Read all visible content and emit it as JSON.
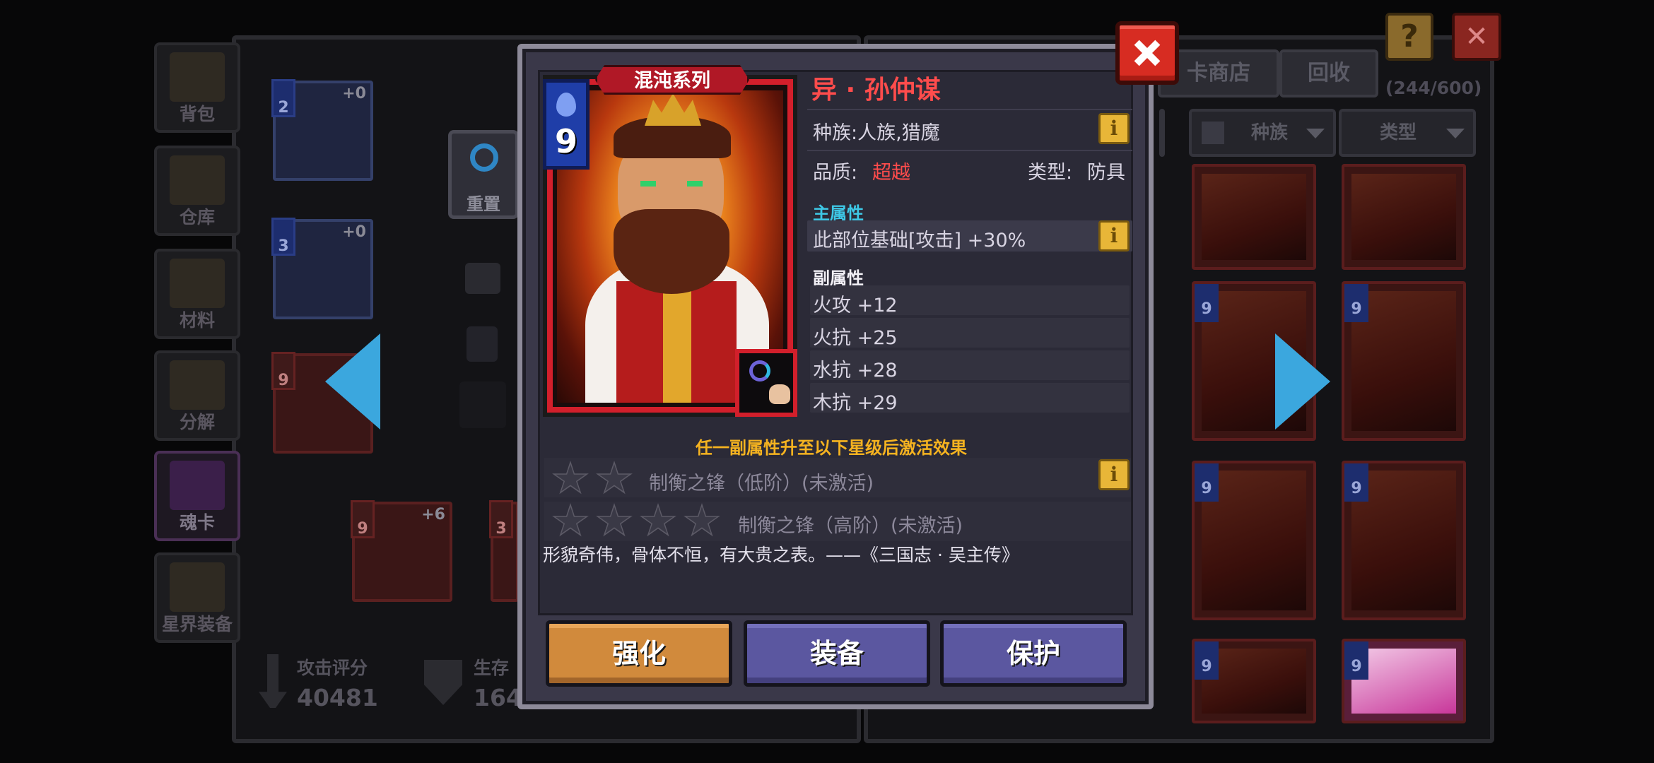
{
  "background": {
    "sidebar": [
      {
        "label": "背包"
      },
      {
        "label": "仓库"
      },
      {
        "label": "材料"
      },
      {
        "label": "分解"
      },
      {
        "label": "魂卡"
      },
      {
        "label": "星界装备"
      }
    ],
    "reset_label": "重置",
    "mini_cards": [
      {
        "cost": "2",
        "plus": "+0"
      },
      {
        "cost": "3",
        "plus": "+0"
      },
      {
        "cost": "9",
        "plus": ""
      },
      {
        "cost": "9",
        "plus": "+6"
      },
      {
        "cost": "3",
        "plus": ""
      }
    ],
    "score": {
      "attack_label": "攻击评分",
      "attack_value": "40481",
      "survive_label": "生存",
      "survive_value": "164"
    },
    "top_buttons": {
      "shop": "卡商店",
      "recycle": "回收",
      "count": "(244/600)"
    },
    "filters": {
      "race": "种族",
      "type": "类型"
    },
    "grid_costs": [
      "9",
      "9",
      "9",
      "9",
      "9",
      "9"
    ],
    "grid_series": [
      "混沌系列",
      "混沌系列"
    ]
  },
  "modal": {
    "series": "混沌系列",
    "cost": "9",
    "name": "异 · 孙仲谋",
    "race_text": "种族:人族,猎魔",
    "quality_label": "品质:",
    "quality_value": "超越",
    "type_label": "类型:",
    "type_value": "防具",
    "main_attr_title": "主属性",
    "main_attr": "此部位基础[攻击] +30%",
    "sub_attr_title": "副属性",
    "sub_attrs": [
      "火攻 +12",
      "火抗 +25",
      "水抗 +28",
      "木抗 +29"
    ],
    "activation_note": "任一副属性升至以下星级后激活效果",
    "effects": [
      {
        "stars": 2,
        "text": "制衡之锋（低阶）(未激活)"
      },
      {
        "stars": 4,
        "text": "制衡之锋（高阶）(未激活)"
      }
    ],
    "quote": "形貌奇伟，骨体不恒，有大贵之表。——《三国志 · 吴主传》",
    "buttons": {
      "enhance": "强化",
      "equip": "装备",
      "protect": "保护"
    }
  },
  "colors": {
    "accent_red": "#ff4c4c",
    "cyan": "#3ec8e6",
    "gold": "#f5b320",
    "button_orange": "#d18a3c",
    "button_purple": "#5b57a0"
  }
}
